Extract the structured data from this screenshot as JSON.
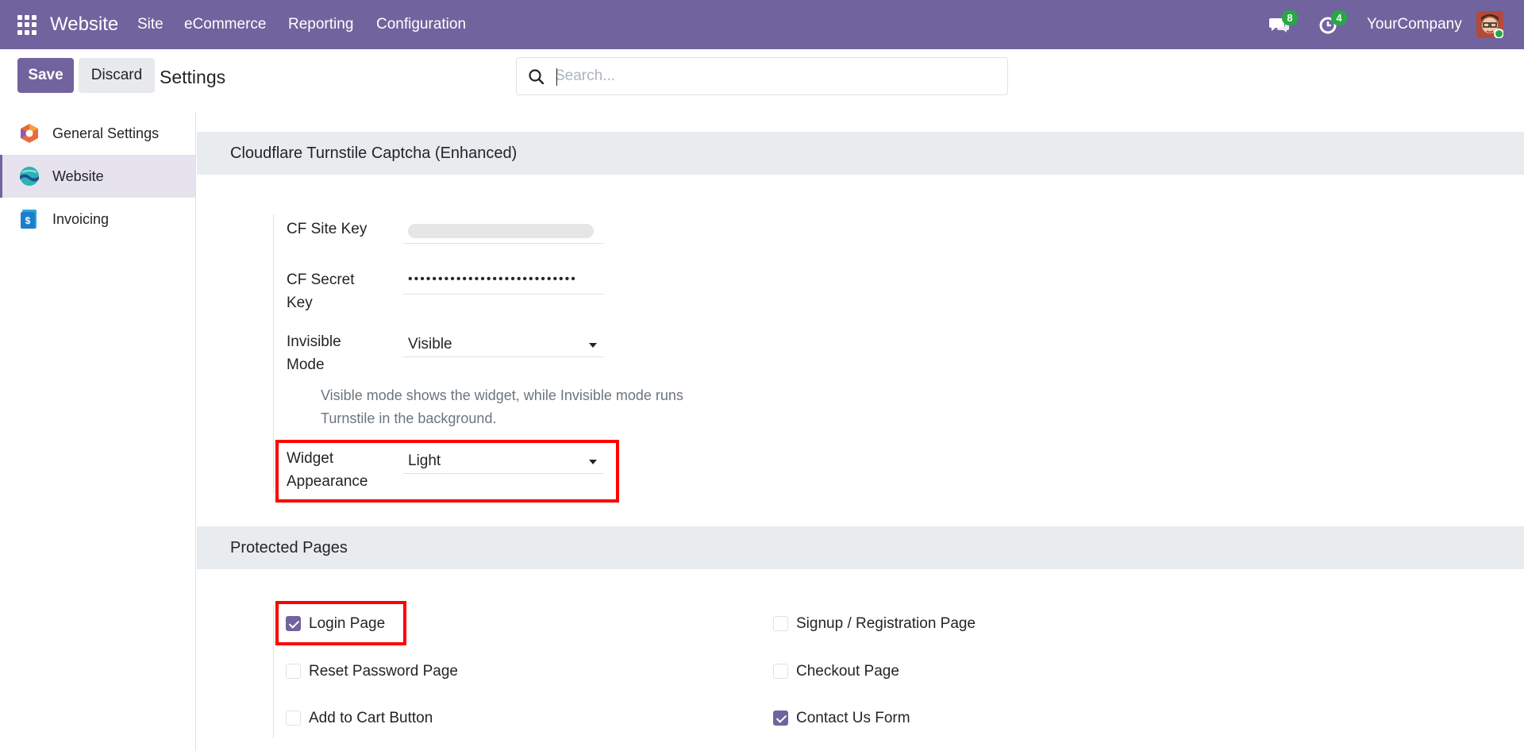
{
  "navbar": {
    "brand": "Website",
    "menu": [
      "Site",
      "eCommerce",
      "Reporting",
      "Configuration"
    ],
    "messages_count": "8",
    "activities_count": "4",
    "company": "YourCompany",
    "bg_color": "#71639e",
    "icons": [
      "apps-grid-icon",
      "chat-icon",
      "clock-icon"
    ]
  },
  "control_panel": {
    "save_label": "Save",
    "discard_label": "Discard",
    "title": "Settings",
    "search_placeholder": "Search..."
  },
  "sidebar": {
    "items": [
      {
        "label": "General Settings",
        "icon": "general-settings-icon",
        "active": false
      },
      {
        "label": "Website",
        "icon": "website-app-icon",
        "active": true
      },
      {
        "label": "Invoicing",
        "icon": "invoicing-app-icon",
        "active": false
      }
    ]
  },
  "captcha_section": {
    "title": "Cloudflare Turnstile Captcha (Enhanced)",
    "site_key_label": "CF Site Key",
    "secret_key_label_1": "CF Secret",
    "secret_key_label_2": "Key",
    "secret_key_value": "••••••••••••••••••••••••••••",
    "invisible_mode_label_1": "Invisible",
    "invisible_mode_label_2": "Mode",
    "invisible_mode_value": "Visible",
    "invisible_mode_help_1": "Visible mode shows the widget, while Invisible mode runs",
    "invisible_mode_help_2": "Turnstile in the background.",
    "appearance_label_1": "Widget",
    "appearance_label_2": "Appearance",
    "appearance_value": "Light"
  },
  "protected_pages": {
    "title": "Protected Pages",
    "items": [
      {
        "label": "Login Page",
        "checked": true
      },
      {
        "label": "Signup / Registration Page",
        "checked": false
      },
      {
        "label": "Reset Password Page",
        "checked": false
      },
      {
        "label": "Checkout Page",
        "checked": false
      },
      {
        "label": "Add to Cart Button",
        "checked": false
      },
      {
        "label": "Contact Us Form",
        "checked": true
      }
    ]
  },
  "colors": {
    "accent": "#71639e",
    "highlight": "#ff0000",
    "badge": "#28a745"
  }
}
